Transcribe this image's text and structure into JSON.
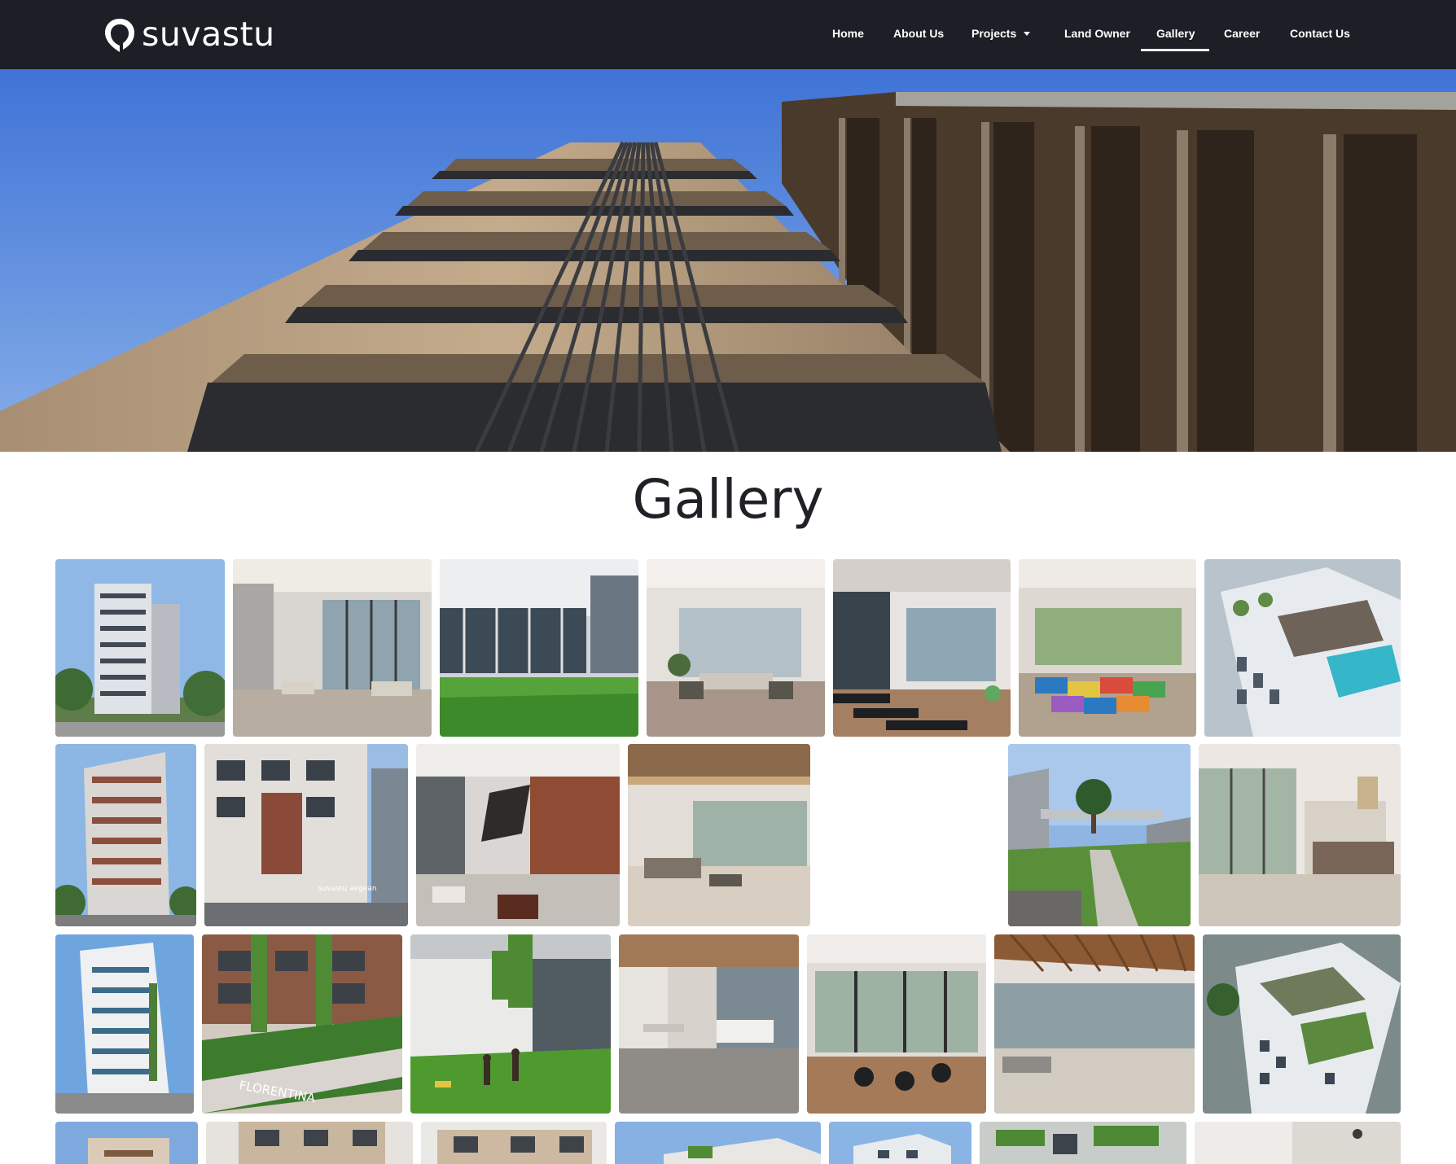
{
  "brand": {
    "name": "suvastu"
  },
  "nav": {
    "items": [
      {
        "label": "Home"
      },
      {
        "label": "About Us"
      },
      {
        "label": "Projects"
      },
      {
        "label": "Land Owner"
      },
      {
        "label": "Gallery"
      },
      {
        "label": "Career"
      },
      {
        "label": "Contact Us"
      }
    ],
    "active": "Gallery"
  },
  "page": {
    "title": "Gallery"
  },
  "gallery": {
    "thumb_captions": {
      "aegean_sign": "suvastu aegean",
      "florentina_sign": "FLORENTINA"
    }
  }
}
